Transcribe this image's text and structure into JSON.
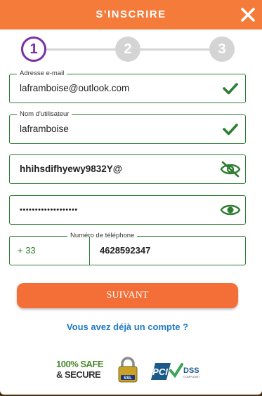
{
  "header": {
    "title": "S'INSCRIRE",
    "close_icon": "close-icon"
  },
  "stepper": {
    "steps": [
      {
        "label": "1",
        "state": "active"
      },
      {
        "label": "2",
        "state": "inactive"
      },
      {
        "label": "3",
        "state": "inactive"
      }
    ]
  },
  "form": {
    "email": {
      "label": "Adresse e-mail",
      "value": "laframboise@outlook.com",
      "status_icon": "check-icon"
    },
    "username": {
      "label": "Nom d'utilisateur",
      "value": "laframboise",
      "status_icon": "check-icon"
    },
    "password_visible": {
      "value": "hhihsdifhyewy9832Y@",
      "toggle_icon": "eye-off-icon"
    },
    "password_confirm": {
      "value": "•••••••••••••••••••",
      "toggle_icon": "eye-icon"
    },
    "phone": {
      "label": "Numéro de téléphone",
      "country_code": "+ 33",
      "number": "4628592347"
    }
  },
  "actions": {
    "submit_label": "SUIVANT",
    "login_link": "Vous avez déjà un compte ?"
  },
  "badges": {
    "safe_line1": "100% SAFE",
    "safe_line2": "& SECURE",
    "ssl_text": "SSL",
    "pci_text": "PCI",
    "dss_text": "DSS",
    "compliant_text": "COMPLIANT"
  },
  "colors": {
    "accent": "#f47b3a",
    "active_step": "#7b2fa6",
    "valid": "#2e7d32",
    "link": "#1f7ac6"
  }
}
